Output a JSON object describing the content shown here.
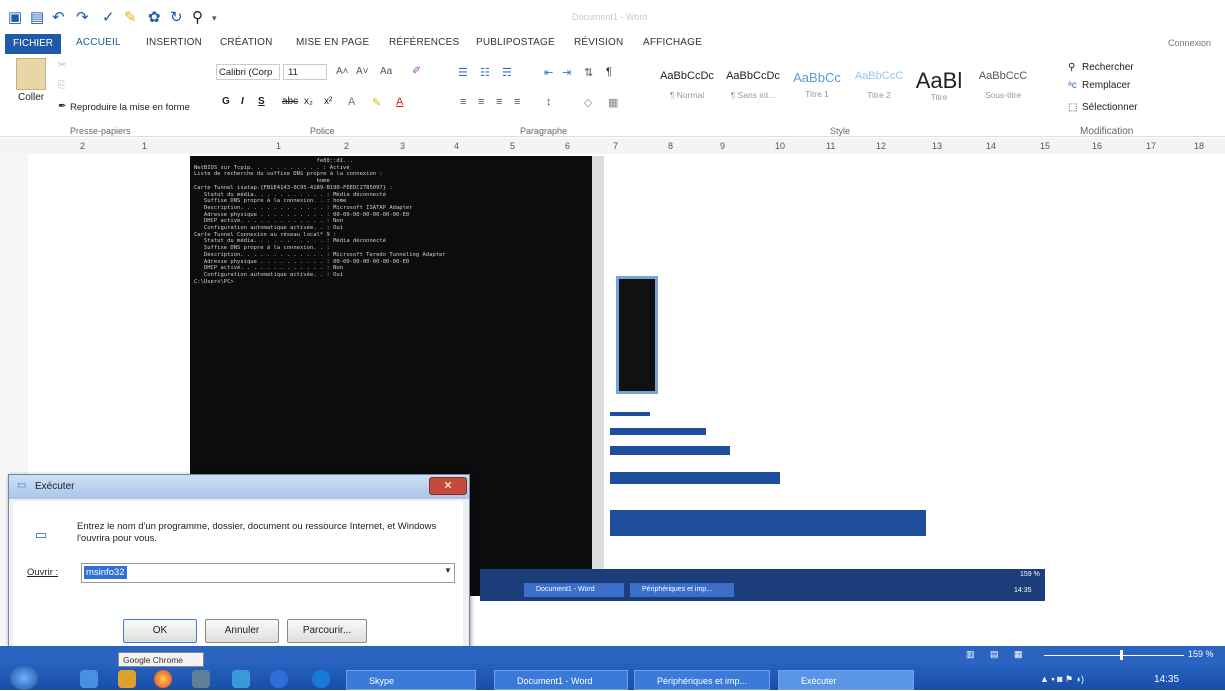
{
  "app": {
    "window_title": "Document1 - Word",
    "account": "Connexion"
  },
  "ribbon_tabs": [
    "FICHIER",
    "ACCUEIL",
    "INSERTION",
    "CRÉATION",
    "MISE EN PAGE",
    "RÉFÉRENCES",
    "PUBLIPOSTAGE",
    "RÉVISION",
    "AFFICHAGE"
  ],
  "clipboard": {
    "paste": "Coller",
    "format_painter": "Reproduire la mise en forme",
    "group": "Presse-papiers"
  },
  "font": {
    "name": "Calibri (Corp",
    "size": "11",
    "group": "Police"
  },
  "paragraph": {
    "group": "Paragraphe"
  },
  "styles": {
    "group": "Style",
    "items": [
      {
        "sample": "AaBbCcDc",
        "name": "¶ Normal"
      },
      {
        "sample": "AaBbCcDc",
        "name": "¶ Sans int..."
      },
      {
        "sample": "AaBbCc",
        "name": "Titre 1"
      },
      {
        "sample": "AaBbCcC",
        "name": "Titre 2"
      },
      {
        "sample": "AaBl",
        "name": "Titre"
      },
      {
        "sample": "AaBbCcC",
        "name": "Sous-titre"
      }
    ]
  },
  "editing": {
    "find": "Rechercher",
    "replace": "Remplacer",
    "select": "Sélectionner",
    "group": "Modification"
  },
  "ruler_numbers": [
    "2",
    "1",
    "1",
    "2",
    "3",
    "4",
    "5",
    "6",
    "7",
    "8",
    "9",
    "10",
    "11",
    "12",
    "13",
    "14",
    "15",
    "16",
    "17",
    "18"
  ],
  "cmd_lines": [
    "                                     fe80::d1...",
    "NetBIOS sur Tcpip. . . . . . . . . . . : Activé",
    "Liste de recherche du suffixe DNS propre à la connexion :",
    "                                     home",
    "",
    "Carte Tunnel isatap.{FB1E4143-0C95-4189-B190-F6EDC2785097} :",
    "",
    "   Statut du média. . . . . . . . . . . : Média déconnecté",
    "   Suffixe DNS propre à la connexion. . : home",
    "   Description. . . . . . . . . . . . . : Microsoft ISATAP Adapter",
    "   Adresse physique . . . . . . . . . . : 00-00-00-00-00-00-00-E0",
    "   DHCP activé. . . . . . . . . . . . . : Non",
    "   Configuration automatique activée. . : Oui",
    "",
    "Carte Tunnel Connexion au réseau local* 9 :",
    "",
    "   Statut du média. . . . . . . . . . . : Média déconnecté",
    "   Suffixe DNS propre à la connexion. . :",
    "   Description. . . . . . . . . . . . . : Microsoft Teredo Tunneling Adapter",
    "   Adresse physique . . . . . . . . . . : 00-00-00-00-00-00-00-E0",
    "   DHCP activé. . . . . . . . . . . . . : Non",
    "   Configuration automatique activée. . : Oui",
    "",
    "C:\\Users\\PC>"
  ],
  "run_dialog": {
    "title": "Exécuter",
    "message": "Entrez le nom d'un programme, dossier, document ou ressource Internet, et Windows l'ouvrira pour vous.",
    "open_label": "Ouvrir :",
    "open_value": "msinfo32",
    "ok": "OK",
    "cancel": "Annuler",
    "browse": "Parcourir..."
  },
  "tooltip": "Google Chrome",
  "taskbar": {
    "items": [
      "Skype",
      "Document1 - Word",
      "Périphériques et imp...",
      "Exécuter"
    ],
    "zoom": "159 %",
    "clock": "14:35"
  },
  "inner_taskbar": {
    "items": [
      "Document1 - Word",
      "Périphériques et imp..."
    ],
    "zoom": "159 %",
    "clock": "14:35"
  },
  "colors": {
    "word_blue": "#1e5aa8",
    "taskbar": "#1a4ea8",
    "dialog_close": "#c44a3a",
    "selection": "#3170d8"
  }
}
